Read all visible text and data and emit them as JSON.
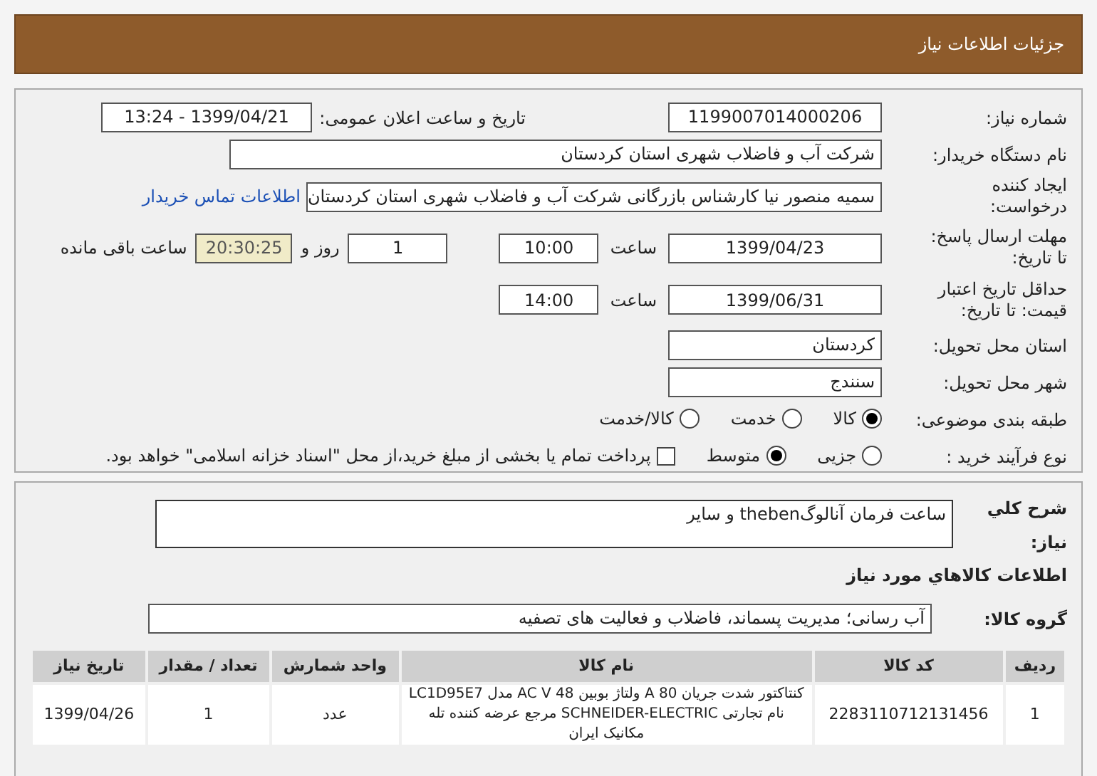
{
  "header": {
    "title": "جزئیات اطلاعات نیاز"
  },
  "need_number": {
    "label": "شماره نیاز:",
    "value": "1199007014000206"
  },
  "announce": {
    "label": "تاریخ و ساعت اعلان عمومی:",
    "value": "1399/04/21 - 13:24"
  },
  "buyer": {
    "label": "نام دستگاه خریدار:",
    "value": "شرکت آب و فاضلاب شهری استان کردستان"
  },
  "creator": {
    "label": "ایجاد کننده درخواست:",
    "value": "سمیه منصور نیا کارشناس بازرگانی شرکت آب و فاضلاب شهری استان کردستان",
    "link": "اطلاعات تماس خریدار"
  },
  "deadline": {
    "label": "مهلت ارسال پاسخ: تا تاریخ:",
    "date": "1399/04/23",
    "time_label": "ساعت",
    "time": "10:00",
    "days": "1",
    "days_label": "روز و",
    "remaining": "20:30:25",
    "remaining_label": "ساعت باقی مانده"
  },
  "validity": {
    "label": "حداقل تاریخ اعتبار قیمت: تا تاریخ:",
    "date": "1399/06/31",
    "time_label": "ساعت",
    "time": "14:00"
  },
  "province": {
    "label": "استان محل تحویل:",
    "value": "کردستان"
  },
  "city": {
    "label": "شهر محل تحویل:",
    "value": "سنندج"
  },
  "category": {
    "label": "طبقه بندی موضوعی:",
    "options": [
      {
        "label": "کالا",
        "selected": true
      },
      {
        "label": "خدمت",
        "selected": false
      },
      {
        "label": "کالا/خدمت",
        "selected": false
      }
    ]
  },
  "process": {
    "label": "نوع فرآیند خرید :",
    "options": [
      {
        "label": "جزیی",
        "selected": false
      },
      {
        "label": "متوسط",
        "selected": true
      }
    ],
    "payment": {
      "label": "پرداخت تمام یا بخشی از مبلغ خرید،از محل \"اسناد خزانه اسلامی\" خواهد بود.",
      "checked": false
    }
  },
  "description": {
    "label": "شرح کلي نياز:",
    "value": "ساعت فرمان آنالوگtheben و سایر"
  },
  "goods_heading": "اطلاعات کالاهاي مورد نياز",
  "goods_group": {
    "label": "گروه کالا:",
    "value": "آب رسانی؛ مدیریت پسماند، فاضلاب و فعالیت های تصفیه"
  },
  "table": {
    "columns": [
      "ردیف",
      "کد کالا",
      "نام کالا",
      "واحد شمارش",
      "تعداد / مقدار",
      "تاریخ نیاز"
    ],
    "rows": [
      [
        "1",
        "2283110712131456",
        "کنتاکتور شدت جریان 80 A ولتاژ بوبین 48 AC V مدل LC1D95E7 نام تجارتی SCHNEIDER-ELECTRIC مرجع عرضه کننده تله مکانیک ایران",
        "عدد",
        "1",
        "1399/04/26"
      ]
    ]
  }
}
